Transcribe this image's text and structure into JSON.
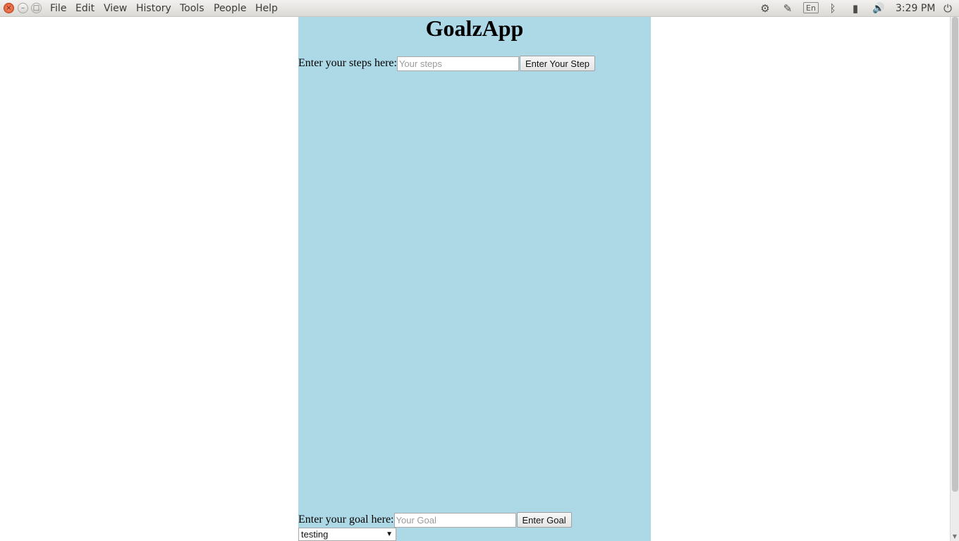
{
  "menubar": {
    "window_controls": {
      "close_icon": "×",
      "minimize_icon": "–",
      "maximize_icon": "□"
    },
    "menus": [
      "File",
      "Edit",
      "View",
      "History",
      "Tools",
      "People",
      "Help"
    ],
    "tray": {
      "settings_icon": "⚙",
      "network_icon": "✎",
      "keyboard_layout": "En",
      "bluetooth_icon": "ᛒ",
      "battery_icon": "▮",
      "volume_icon": "🔊",
      "clock": "3:29 PM",
      "power_icon": "⏻"
    }
  },
  "app": {
    "title": "GoalzApp",
    "background_color": "#add8e6",
    "steps": {
      "label": "Enter your steps here:",
      "placeholder": "Your steps",
      "button_label": "Enter Your Step"
    },
    "goal": {
      "label": "Enter your goal here:",
      "placeholder": "Your Goal",
      "button_label": "Enter Goal"
    },
    "goal_select": {
      "selected": "testing",
      "arrow_icon": "▼"
    }
  },
  "scrollbar": {
    "down_arrow_icon": "▼"
  }
}
